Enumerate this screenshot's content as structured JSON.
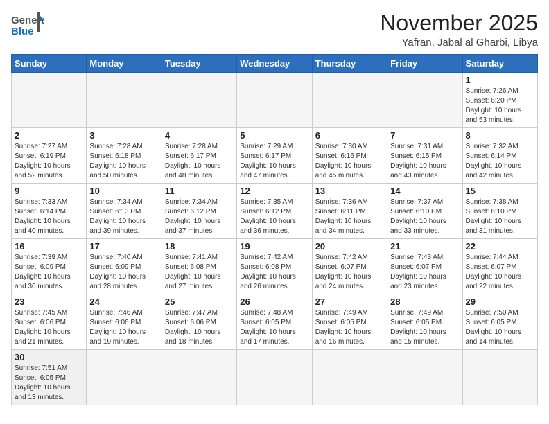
{
  "header": {
    "logo_general": "General",
    "logo_blue": "Blue",
    "month": "November 2025",
    "location": "Yafran, Jabal al Gharbi, Libya"
  },
  "weekdays": [
    "Sunday",
    "Monday",
    "Tuesday",
    "Wednesday",
    "Thursday",
    "Friday",
    "Saturday"
  ],
  "weeks": [
    [
      {
        "day": "",
        "info": ""
      },
      {
        "day": "",
        "info": ""
      },
      {
        "day": "",
        "info": ""
      },
      {
        "day": "",
        "info": ""
      },
      {
        "day": "",
        "info": ""
      },
      {
        "day": "",
        "info": ""
      },
      {
        "day": "1",
        "info": "Sunrise: 7:26 AM\nSunset: 6:20 PM\nDaylight: 10 hours\nand 53 minutes."
      }
    ],
    [
      {
        "day": "2",
        "info": "Sunrise: 7:27 AM\nSunset: 6:19 PM\nDaylight: 10 hours\nand 52 minutes."
      },
      {
        "day": "3",
        "info": "Sunrise: 7:28 AM\nSunset: 6:18 PM\nDaylight: 10 hours\nand 50 minutes."
      },
      {
        "day": "4",
        "info": "Sunrise: 7:28 AM\nSunset: 6:17 PM\nDaylight: 10 hours\nand 48 minutes."
      },
      {
        "day": "5",
        "info": "Sunrise: 7:29 AM\nSunset: 6:17 PM\nDaylight: 10 hours\nand 47 minutes."
      },
      {
        "day": "6",
        "info": "Sunrise: 7:30 AM\nSunset: 6:16 PM\nDaylight: 10 hours\nand 45 minutes."
      },
      {
        "day": "7",
        "info": "Sunrise: 7:31 AM\nSunset: 6:15 PM\nDaylight: 10 hours\nand 43 minutes."
      },
      {
        "day": "8",
        "info": "Sunrise: 7:32 AM\nSunset: 6:14 PM\nDaylight: 10 hours\nand 42 minutes."
      }
    ],
    [
      {
        "day": "9",
        "info": "Sunrise: 7:33 AM\nSunset: 6:14 PM\nDaylight: 10 hours\nand 40 minutes."
      },
      {
        "day": "10",
        "info": "Sunrise: 7:34 AM\nSunset: 6:13 PM\nDaylight: 10 hours\nand 39 minutes."
      },
      {
        "day": "11",
        "info": "Sunrise: 7:34 AM\nSunset: 6:12 PM\nDaylight: 10 hours\nand 37 minutes."
      },
      {
        "day": "12",
        "info": "Sunrise: 7:35 AM\nSunset: 6:12 PM\nDaylight: 10 hours\nand 36 minutes."
      },
      {
        "day": "13",
        "info": "Sunrise: 7:36 AM\nSunset: 6:11 PM\nDaylight: 10 hours\nand 34 minutes."
      },
      {
        "day": "14",
        "info": "Sunrise: 7:37 AM\nSunset: 6:10 PM\nDaylight: 10 hours\nand 33 minutes."
      },
      {
        "day": "15",
        "info": "Sunrise: 7:38 AM\nSunset: 6:10 PM\nDaylight: 10 hours\nand 31 minutes."
      }
    ],
    [
      {
        "day": "16",
        "info": "Sunrise: 7:39 AM\nSunset: 6:09 PM\nDaylight: 10 hours\nand 30 minutes."
      },
      {
        "day": "17",
        "info": "Sunrise: 7:40 AM\nSunset: 6:09 PM\nDaylight: 10 hours\nand 28 minutes."
      },
      {
        "day": "18",
        "info": "Sunrise: 7:41 AM\nSunset: 6:08 PM\nDaylight: 10 hours\nand 27 minutes."
      },
      {
        "day": "19",
        "info": "Sunrise: 7:42 AM\nSunset: 6:08 PM\nDaylight: 10 hours\nand 26 minutes."
      },
      {
        "day": "20",
        "info": "Sunrise: 7:42 AM\nSunset: 6:07 PM\nDaylight: 10 hours\nand 24 minutes."
      },
      {
        "day": "21",
        "info": "Sunrise: 7:43 AM\nSunset: 6:07 PM\nDaylight: 10 hours\nand 23 minutes."
      },
      {
        "day": "22",
        "info": "Sunrise: 7:44 AM\nSunset: 6:07 PM\nDaylight: 10 hours\nand 22 minutes."
      }
    ],
    [
      {
        "day": "23",
        "info": "Sunrise: 7:45 AM\nSunset: 6:06 PM\nDaylight: 10 hours\nand 21 minutes."
      },
      {
        "day": "24",
        "info": "Sunrise: 7:46 AM\nSunset: 6:06 PM\nDaylight: 10 hours\nand 19 minutes."
      },
      {
        "day": "25",
        "info": "Sunrise: 7:47 AM\nSunset: 6:06 PM\nDaylight: 10 hours\nand 18 minutes."
      },
      {
        "day": "26",
        "info": "Sunrise: 7:48 AM\nSunset: 6:05 PM\nDaylight: 10 hours\nand 17 minutes."
      },
      {
        "day": "27",
        "info": "Sunrise: 7:49 AM\nSunset: 6:05 PM\nDaylight: 10 hours\nand 16 minutes."
      },
      {
        "day": "28",
        "info": "Sunrise: 7:49 AM\nSunset: 6:05 PM\nDaylight: 10 hours\nand 15 minutes."
      },
      {
        "day": "29",
        "info": "Sunrise: 7:50 AM\nSunset: 6:05 PM\nDaylight: 10 hours\nand 14 minutes."
      }
    ],
    [
      {
        "day": "30",
        "info": "Sunrise: 7:51 AM\nSunset: 6:05 PM\nDaylight: 10 hours\nand 13 minutes."
      },
      {
        "day": "",
        "info": ""
      },
      {
        "day": "",
        "info": ""
      },
      {
        "day": "",
        "info": ""
      },
      {
        "day": "",
        "info": ""
      },
      {
        "day": "",
        "info": ""
      },
      {
        "day": "",
        "info": ""
      }
    ]
  ]
}
